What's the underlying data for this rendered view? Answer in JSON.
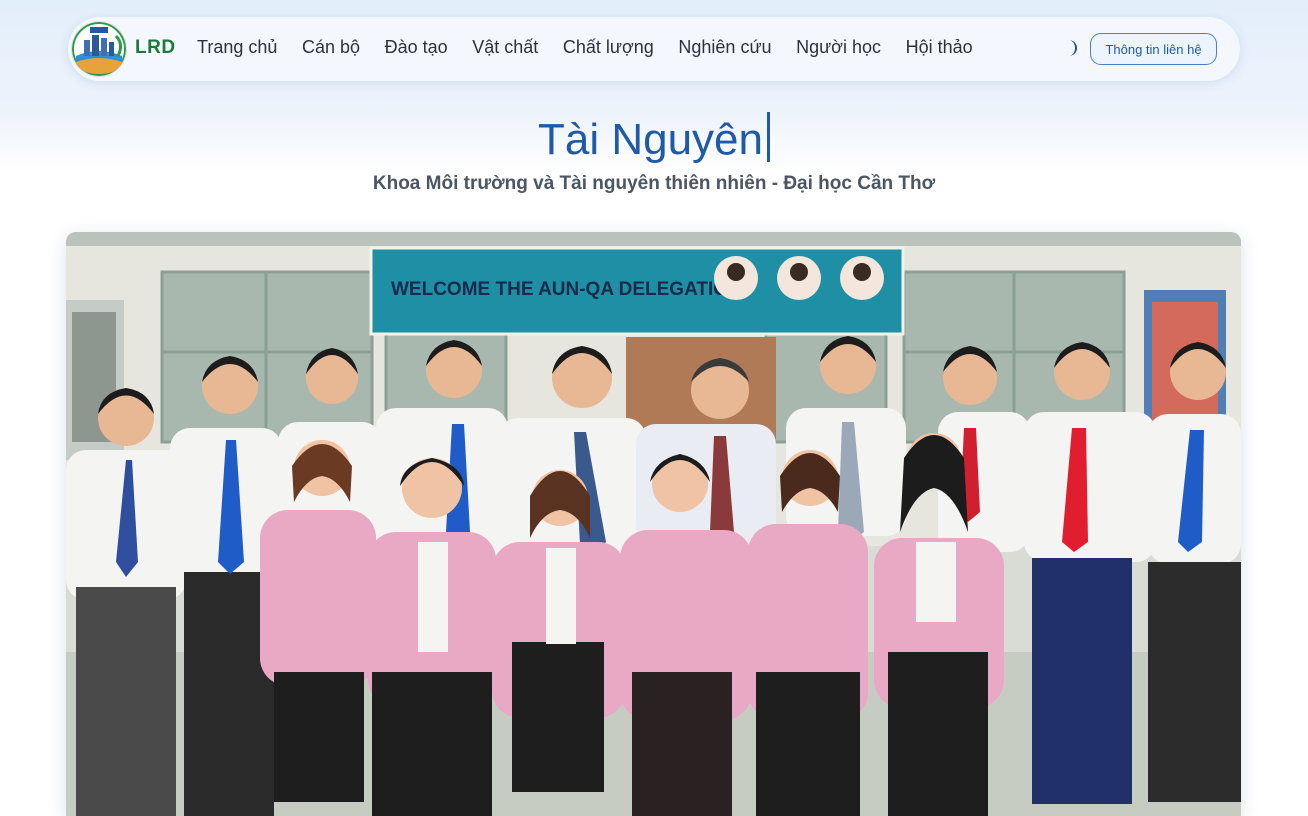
{
  "header": {
    "brand": "LRD",
    "nav": [
      "Trang chủ",
      "Cán bộ",
      "Đào tạo",
      "Vật chất",
      "Chất lượng",
      "Nghiên cứu",
      "Người học",
      "Hội thảo"
    ],
    "theme_toggle_icon": "moon-icon",
    "contact_button": "Thông tin liên hệ"
  },
  "hero": {
    "title": "Tài Nguyên",
    "subtitle": "Khoa Môi trường và Tài nguyên thiên nhiên - Đại học Cần Thơ"
  },
  "photo": {
    "banner_text": "WELCOME THE AUN-QA DELEGATION"
  },
  "colors": {
    "accent": "#1f5aa8",
    "brand_green": "#1b7a3a",
    "jacket_pink": "#e9a8c4",
    "banner_teal": "#1f8fa6"
  }
}
